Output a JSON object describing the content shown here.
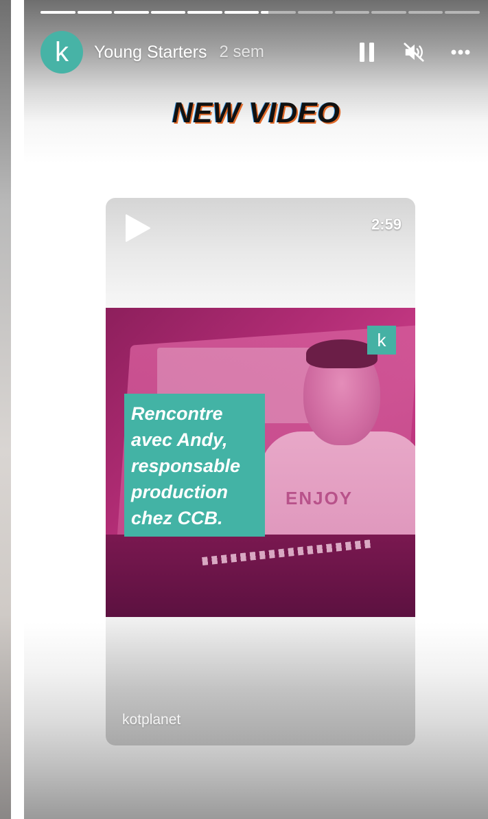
{
  "story": {
    "progress": {
      "segment_count": 12,
      "completed_segments": 6,
      "current_segment_fraction": 0.2
    },
    "header": {
      "avatar_letter": "k",
      "account_name": "Young Starters",
      "post_age": "2 sem",
      "controls": {
        "pause_icon": "pause-icon",
        "mute_icon": "volume-muted-icon",
        "more_icon": "more-options-icon"
      }
    },
    "title": "NEW VIDEO",
    "card": {
      "play_icon": "play-icon",
      "duration": "2:59",
      "thumbnail": {
        "logo_letter": "k",
        "caption_lines": [
          "Rencontre",
          "avec Andy,",
          "responsable",
          "production",
          "chez CCB."
        ],
        "shirt_text": "ENJOY"
      },
      "source": "kotplanet"
    },
    "colors": {
      "brand_teal": "#47b3a6",
      "thumbnail_magenta": "#b02c74"
    }
  }
}
